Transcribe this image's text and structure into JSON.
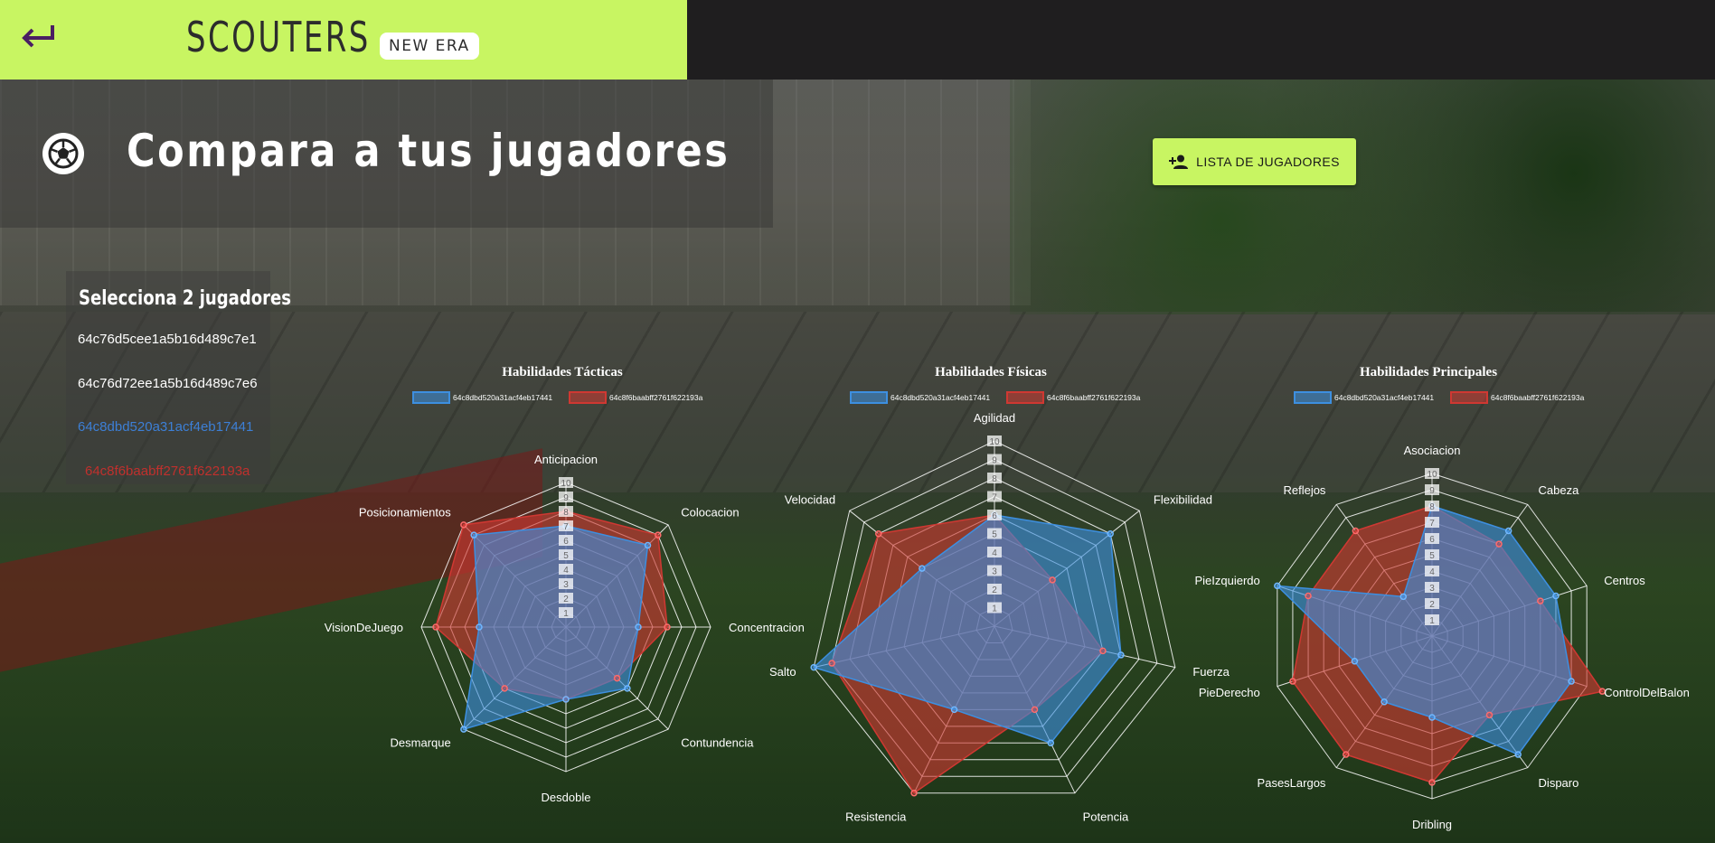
{
  "header": {
    "logo_text": "SCOUTERS",
    "logo_badge": "NEW ERA",
    "accent_color": "#c8f562",
    "dark_color": "#1f1e1f"
  },
  "main": {
    "title": "Compara a tus jugadores",
    "list_button_label": "LISTA DE JUGADORES"
  },
  "selector": {
    "title": "Selecciona 2 jugadores",
    "players": [
      {
        "id": "64c76d5cee1a5b16d489c7e1",
        "color": "#ffffff"
      },
      {
        "id": "64c76d72ee1a5b16d489c7e6",
        "color": "#ffffff"
      },
      {
        "id": "64c8dbd520a31acf4eb17441",
        "color": "#3d7fd6"
      },
      {
        "id": "64c8f6baabff2761f622193a",
        "color": "#c0302d"
      }
    ]
  },
  "legend": {
    "series": [
      {
        "name": "64c8dbd520a31acf4eb17441",
        "color": "#3d8fe0"
      },
      {
        "name": "64c8f6baabff2761f622193a",
        "color": "#cf3832"
      }
    ]
  },
  "chart_data": [
    {
      "type": "radar",
      "title": "Habilidades Tácticas",
      "ticks": [
        "1",
        "2",
        "3",
        "4",
        "5",
        "6",
        "7",
        "8",
        "9",
        "10"
      ],
      "range": [
        0,
        10
      ],
      "categories": [
        "Anticipacion",
        "Colocacion",
        "Concentracion",
        "Contundencia",
        "Desdoble",
        "Desmarque",
        "VisionDeJuego",
        "Posicionamientos"
      ],
      "series": [
        {
          "name": "64c8dbd520a31acf4eb17441",
          "values": [
            7,
            8,
            5,
            6,
            5,
            10,
            6,
            9
          ]
        },
        {
          "name": "64c8f6baabff2761f622193a",
          "values": [
            8,
            9,
            7,
            5,
            5,
            6,
            9,
            10
          ]
        }
      ]
    },
    {
      "type": "radar",
      "title": "Habilidades Físicas",
      "ticks": [
        "1",
        "2",
        "3",
        "4",
        "5",
        "6",
        "7",
        "8",
        "9",
        "10"
      ],
      "range": [
        0,
        10
      ],
      "categories": [
        "Agilidad",
        "Flexibilidad",
        "Fuerza",
        "Potencia",
        "Resistencia",
        "Salto",
        "Velocidad"
      ],
      "series": [
        {
          "name": "64c8dbd520a31acf4eb17441",
          "values": [
            6,
            8,
            7,
            7,
            5,
            10,
            5
          ]
        },
        {
          "name": "64c8f6baabff2761f622193a",
          "values": [
            6,
            4,
            6,
            5,
            10,
            9,
            8
          ]
        }
      ]
    },
    {
      "type": "radar",
      "title": "Habilidades Principales",
      "ticks": [
        "1",
        "2",
        "3",
        "4",
        "5",
        "6",
        "7",
        "8",
        "9",
        "10"
      ],
      "range": [
        0,
        10
      ],
      "categories": [
        "Asociacion",
        "Cabeza",
        "Centros",
        "ControlDelBalon",
        "Disparo",
        "Dribling",
        "PasesLargos",
        "PieDerecho",
        "PieIzquierdo",
        "Reflejos"
      ],
      "series": [
        {
          "name": "64c8dbd520a31acf4eb17441",
          "values": [
            8,
            8,
            8,
            9,
            9,
            5,
            5,
            5,
            10,
            3
          ]
        },
        {
          "name": "64c8f6baabff2761f622193a",
          "values": [
            8,
            7,
            7,
            11,
            6,
            9,
            9,
            9,
            8,
            8
          ]
        }
      ]
    }
  ]
}
